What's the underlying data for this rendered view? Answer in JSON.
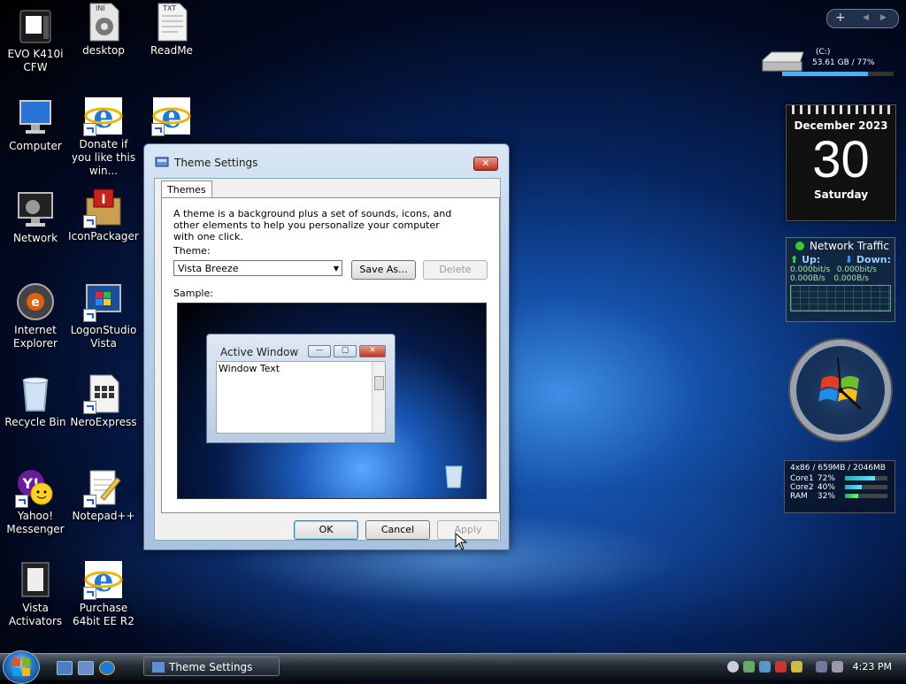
{
  "desktop": {
    "icons": [
      {
        "label": "EVO K410i CFW",
        "icon": "device-icon"
      },
      {
        "label": "desktop",
        "icon": "ini-file-icon",
        "badge": "INI"
      },
      {
        "label": "ReadMe",
        "icon": "txt-file-icon",
        "badge": "TXT"
      },
      {
        "label": "Computer",
        "icon": "computer-icon"
      },
      {
        "label": "Donate if you like this win...",
        "icon": "ie-icon"
      },
      {
        "label": "",
        "icon": "ie-icon"
      },
      {
        "label": "Network",
        "icon": "network-icon"
      },
      {
        "label": "IconPackager",
        "icon": "iconpackager-icon"
      },
      {
        "label": "Internet Explorer",
        "icon": "ie-globe-icon"
      },
      {
        "label": "LogonStudio Vista",
        "icon": "logonstudio-icon"
      },
      {
        "label": "Recycle Bin",
        "icon": "recycle-bin-icon"
      },
      {
        "label": "NeroExpress",
        "icon": "nero-icon"
      },
      {
        "label": "Yahoo! Messenger",
        "icon": "yahoo-icon"
      },
      {
        "label": "Notepad++",
        "icon": "notepad-icon"
      },
      {
        "label": "Vista Activators",
        "icon": "folder-icon"
      },
      {
        "label": "Purchase 64bit EE R2",
        "icon": "ie-icon"
      }
    ]
  },
  "gadgets": {
    "drive": {
      "name": "(C:)",
      "usage": "53.61 GB / 77%",
      "fill_pct": 77
    },
    "calendar": {
      "month": "December 2023",
      "day": "30",
      "weekday": "Saturday"
    },
    "network": {
      "title": "Network Traffic",
      "up_label": "Up:",
      "down_label": "Down:",
      "up_bits": "0.000bit/s",
      "down_bits": "0.000bit/s",
      "up_bytes": "0.000B/s",
      "down_bytes": "0.000B/s"
    },
    "cpu": {
      "header": "4x86 / 659MB / 2046MB",
      "rows": [
        {
          "label": "Core1",
          "value": "72%",
          "pct": 72
        },
        {
          "label": "Core2",
          "value": "40%",
          "pct": 40
        },
        {
          "label": "RAM",
          "value": "32%",
          "pct": 32
        }
      ]
    }
  },
  "dialog": {
    "title": "Theme Settings",
    "close_glyph": "✕",
    "tab": "Themes",
    "description": "A theme is a background plus a set of sounds, icons, and other elements to help you personalize your computer with one click.",
    "theme_label": "Theme:",
    "theme_value": "Vista Breeze",
    "save_as": "Save As...",
    "delete": "Delete",
    "sample_label": "Sample:",
    "sample_window_title": "Active Window",
    "sample_window_text": "Window Text",
    "ok": "OK",
    "cancel": "Cancel",
    "apply": "Apply"
  },
  "taskbar": {
    "task": "Theme Settings",
    "time": "4:23 PM"
  }
}
